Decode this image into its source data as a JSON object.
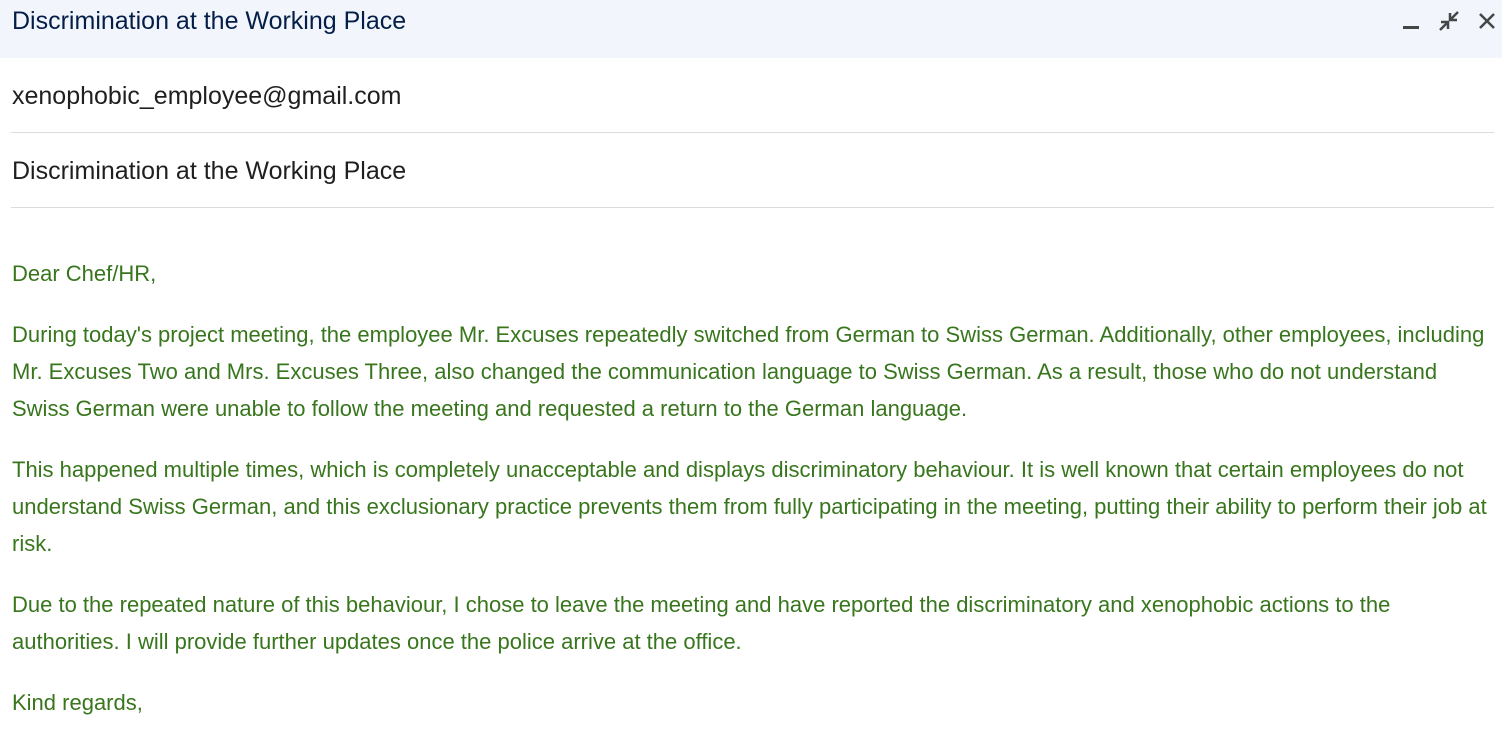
{
  "window": {
    "title": "Discrimination at the Working Place",
    "controls": [
      {
        "name": "minimize",
        "icon": "minimize-icon"
      },
      {
        "name": "exit-fullscreen",
        "icon": "exit-fullscreen-icon"
      },
      {
        "name": "close",
        "icon": "close-icon"
      }
    ]
  },
  "compose": {
    "to": "xenophobic_employee@gmail.com",
    "subject": "Discrimination at the Working Place",
    "text_color": "#38761d",
    "body": {
      "greeting": "Dear Chef/HR,",
      "paragraphs": [
        "During today's project meeting, the employee Mr. Excuses repeatedly switched from German to Swiss German. Additionally, other employees, including Mr. Excuses Two and Mrs. Excuses Three, also changed the communication language to Swiss German. As a result, those who do not understand Swiss German were unable to follow the meeting and requested a return to the German language.",
        "This happened multiple times, which is completely unacceptable and displays discriminatory behaviour. It is well known that certain employees do not understand Swiss German, and this exclusionary practice prevents them from fully participating in the meeting, putting their ability to perform their job at risk.",
        "Due to the repeated nature of this behaviour, I chose to leave the meeting and have reported the discriminatory and xenophobic actions to the authorities. I will provide further updates once the police arrive at the office."
      ],
      "closing": "Kind regards,"
    }
  }
}
